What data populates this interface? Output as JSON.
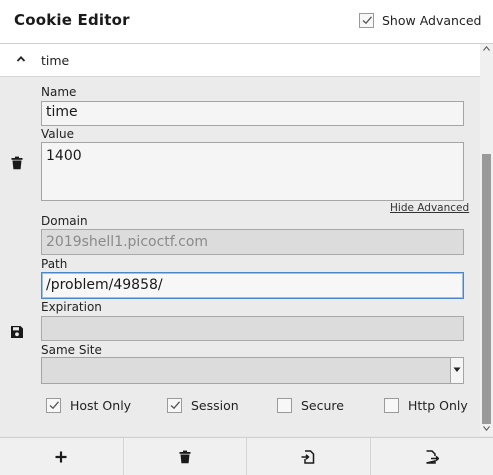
{
  "header": {
    "title": "Cookie Editor",
    "show_advanced_label": "Show Advanced",
    "show_advanced_checked": true
  },
  "cookie": {
    "name": "time",
    "fields": {
      "name_label": "Name",
      "name_value": "time",
      "value_label": "Value",
      "value_value": "1400",
      "hide_advanced": "Hide Advanced",
      "domain_label": "Domain",
      "domain_value": "2019shell1.picoctf.com",
      "path_label": "Path",
      "path_value": "/problem/49858/",
      "expiration_label": "Expiration",
      "expiration_value": "",
      "samesite_label": "Same Site",
      "samesite_value": ""
    },
    "options": [
      {
        "label": "Host Only",
        "checked": true
      },
      {
        "label": "Session",
        "checked": true
      },
      {
        "label": "Secure",
        "checked": false
      },
      {
        "label": "Http Only",
        "checked": false
      }
    ]
  },
  "icons": {
    "collapse": "chevron-up-icon",
    "delete": "trash-icon",
    "save": "save-icon",
    "add": "plus-icon",
    "delete_all": "trash-icon",
    "import": "import-icon",
    "export": "export-icon"
  }
}
